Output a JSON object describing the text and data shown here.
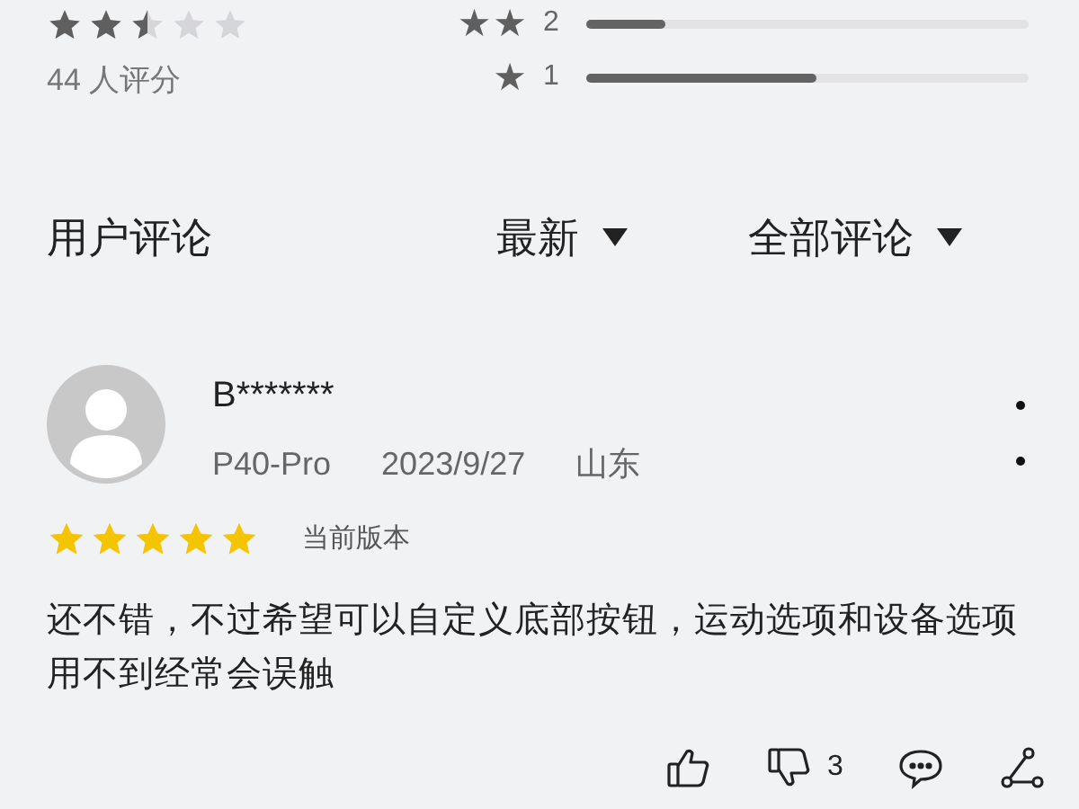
{
  "summary": {
    "stars": 2.5,
    "count_label": "44 人评分"
  },
  "distribution": [
    {
      "star_glyphs": "★★",
      "label": "2",
      "level": 0.18
    },
    {
      "star_glyphs": "★",
      "label": "1",
      "level": 0.52
    }
  ],
  "section": {
    "title": "用户评论",
    "sort": "最新",
    "filter": "全部评论"
  },
  "review": {
    "user": "B*******",
    "device": "P40-Pro",
    "date": "2023/9/27",
    "location": "山东",
    "stars": 5,
    "version_label": "当前版本",
    "text": "还不错，不过希望可以自定义底部按钮，运动选项和设备选项用不到经常会误触",
    "dislike_count": "3"
  }
}
